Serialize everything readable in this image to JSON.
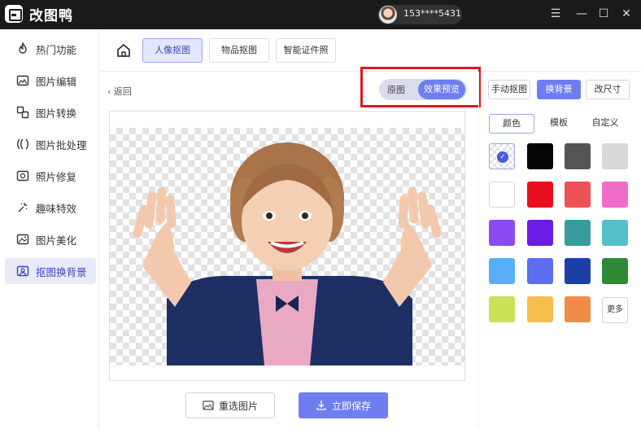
{
  "app": {
    "title": "改图鸭",
    "user_phone": "153****5431"
  },
  "window_controls": [
    {
      "name": "menu-icon",
      "glyph": "☰"
    },
    {
      "name": "minimize-icon",
      "glyph": "—"
    },
    {
      "name": "maximize-icon",
      "glyph": "☐"
    },
    {
      "name": "close-icon",
      "glyph": "✕"
    }
  ],
  "sidebar": {
    "items": [
      {
        "label": "热门功能",
        "icon": "flame-icon"
      },
      {
        "label": "图片编辑",
        "icon": "image-edit-icon"
      },
      {
        "label": "图片转换",
        "icon": "convert-icon"
      },
      {
        "label": "图片批处理",
        "icon": "batch-icon"
      },
      {
        "label": "照片修复",
        "icon": "repair-icon"
      },
      {
        "label": "趣味特效",
        "icon": "sparkle-icon"
      },
      {
        "label": "图片美化",
        "icon": "beautify-icon"
      },
      {
        "label": "抠图换背景",
        "icon": "cutout-icon",
        "active": true
      }
    ]
  },
  "tabs": [
    {
      "label": "人像抠图",
      "active": true
    },
    {
      "label": "物品抠图",
      "active": false
    },
    {
      "label": "智能证件照",
      "active": false
    }
  ],
  "preview": {
    "back_label": "返回",
    "toggle_original": "原图",
    "toggle_preview": "效果预览"
  },
  "actions": {
    "reselect": "重选图片",
    "save": "立即保存"
  },
  "right_panel": {
    "modes": [
      {
        "label": "手动抠图",
        "active": false
      },
      {
        "label": "换背景",
        "active": true
      },
      {
        "label": "改尺寸",
        "active": false
      }
    ],
    "subtabs": [
      {
        "label": "颜色",
        "active": true
      },
      {
        "label": "模板",
        "active": false
      },
      {
        "label": "自定义",
        "active": false
      }
    ],
    "swatches": [
      "transparent",
      "#050505",
      "#555555",
      "#d8d8d8",
      "#ffffff",
      "#e8101f",
      "#ee5156",
      "#f06cc9",
      "#8a4cf2",
      "#6b1be6",
      "#3a9b9e",
      "#55c0c9",
      "#5aaef5",
      "#5c6ff0",
      "#1d3fa8",
      "#2e8a35",
      "#c9e25a",
      "#f6bd4c",
      "#f18c46"
    ],
    "more_label": "更多"
  },
  "colors": {
    "accent": "#6e7ef0",
    "highlight": "#e0161b"
  }
}
